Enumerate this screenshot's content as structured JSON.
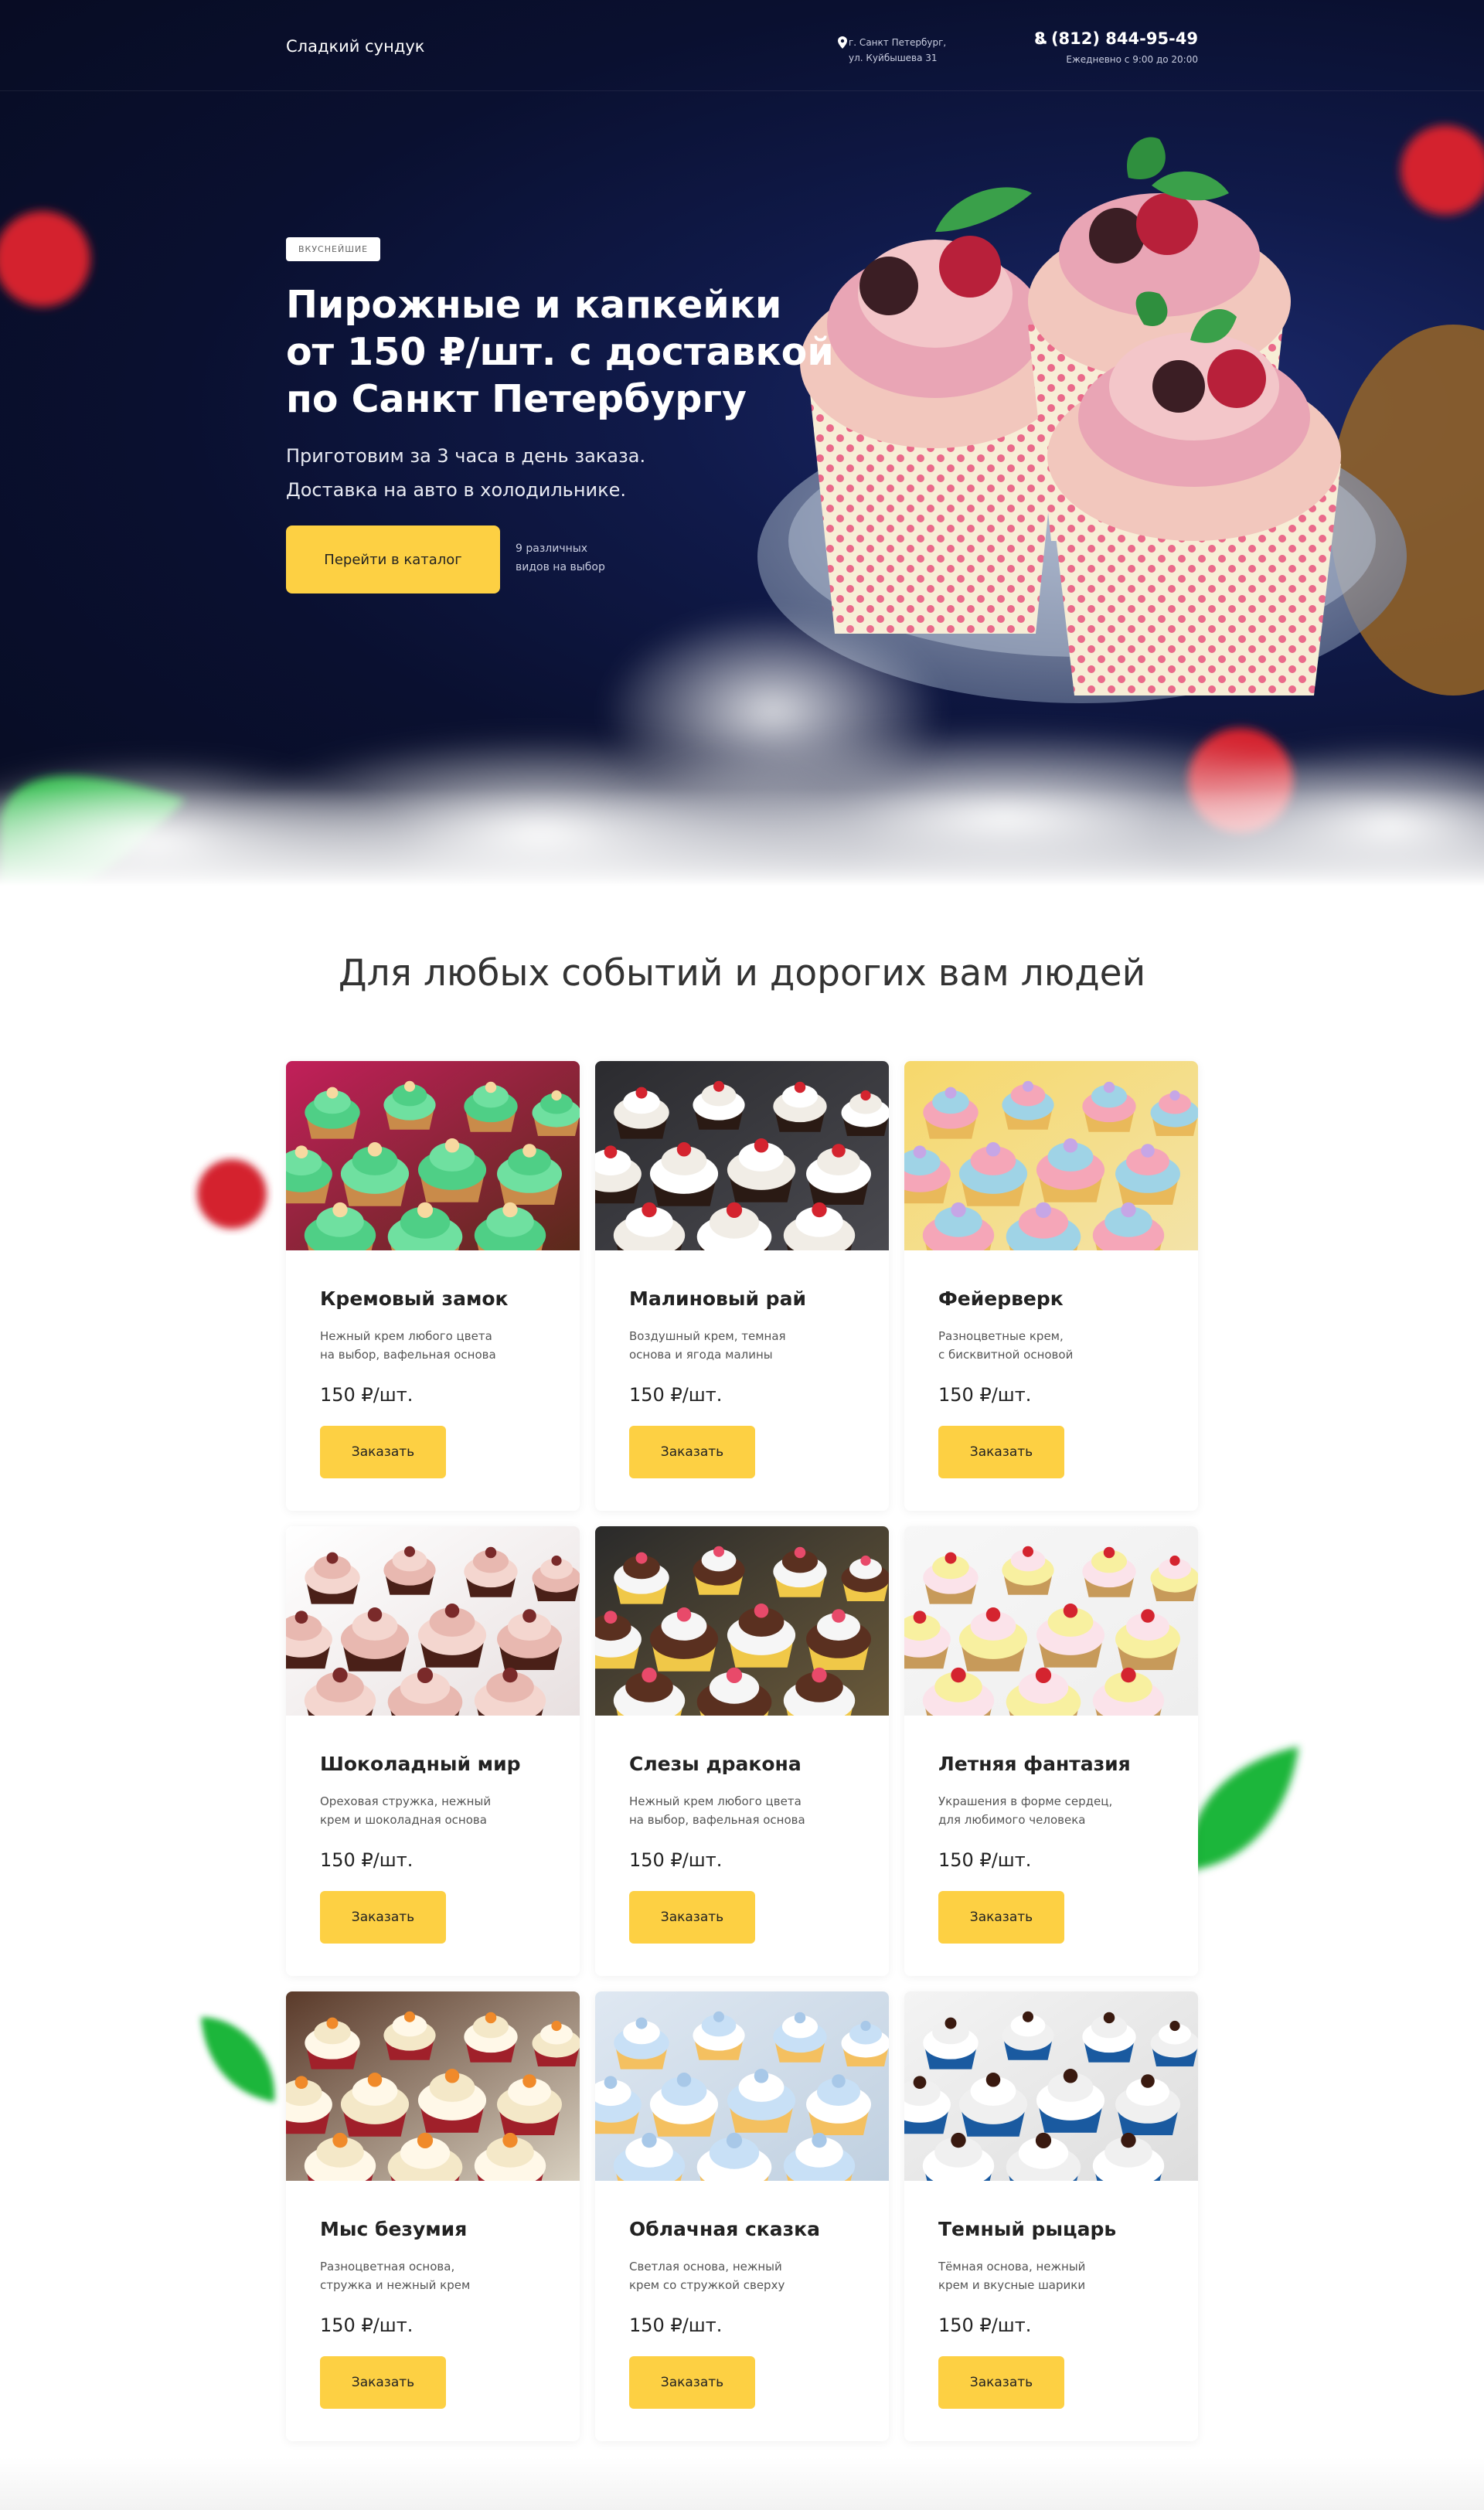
{
  "header": {
    "logo": "Сладкий сундук",
    "address_line1": "г. Санкт Петербург,",
    "address_line2": "ул. Куйбышева 31",
    "phone": "8 (812) 844-95-49",
    "hours": "Ежедневно с 9:00 до 20:00"
  },
  "hero": {
    "badge": "ВКУСНЕЙШИЕ",
    "title_line1": "Пирожные и капкейки",
    "title_line2": "от 150 ₽/шт. с доставкой",
    "title_line3": "по Санкт Петербургу",
    "subtitle_line1": "Приготовим за 3 часа в день заказа.",
    "subtitle_line2": "Доставка на авто в холодильнике.",
    "cta_label": "Перейти в каталог",
    "cta_note_line1": "9 различных",
    "cta_note_line2": "видов на выбор"
  },
  "catalog": {
    "title": "Для любых событий и дорогих вам людей",
    "order_label": "Заказать",
    "items": [
      {
        "name": "Кремовый замок",
        "desc": "Нежный крем любого цвета\nна выбор, вафельная основа",
        "price": "150 ₽/шт.",
        "theme": "green-cream"
      },
      {
        "name": "Малиновый рай",
        "desc": "Воздушный крем, темная\nоснова и ягода малины",
        "price": "150 ₽/шт.",
        "theme": "raspberry-dark"
      },
      {
        "name": "Фейерверк",
        "desc": "Разноцветные крем,\nс бисквитной основой",
        "price": "150 ₽/шт.",
        "theme": "pastel-multi"
      },
      {
        "name": "Шоколадный мир",
        "desc": "Ореховая стружка, нежный\nкрем и шоколадная основа",
        "price": "150 ₽/шт.",
        "theme": "choco-cream"
      },
      {
        "name": "Слезы дракона",
        "desc": "Нежный крем любого цвета\nна выбор, вафельная основа",
        "price": "150 ₽/шт.",
        "theme": "sprinkles"
      },
      {
        "name": "Летняя фантазия",
        "desc": "Украшения в форме сердец,\nдля любимого человека",
        "price": "150 ₽/шт.",
        "theme": "hearts"
      },
      {
        "name": "Мыс безумия",
        "desc": "Разноцветная основа,\nстружка и нежный крем",
        "price": "150 ₽/шт.",
        "theme": "redvelvet"
      },
      {
        "name": "Облачная сказка",
        "desc": "Светлая основа, нежный\nкрем со стружкой сверху",
        "price": "150 ₽/шт.",
        "theme": "cloud-blue"
      },
      {
        "name": "Темный рыцарь",
        "desc": "Тёмная основа, нежный\nкрем и вкусные шарики",
        "price": "150 ₽/шт.",
        "theme": "dark-blue"
      }
    ]
  },
  "colors": {
    "accent": "#fdd043",
    "hero_bg": "#0a1030"
  },
  "icons": {
    "address": "map-pin-icon",
    "phone": "phone-icon"
  }
}
